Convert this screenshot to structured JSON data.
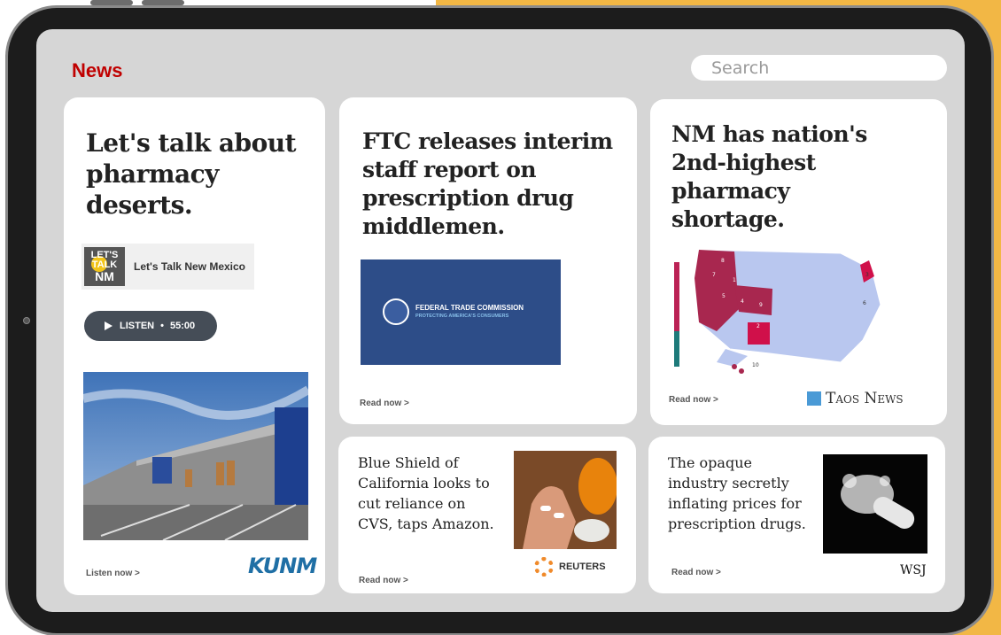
{
  "app": {
    "section_title": "News",
    "search": {
      "placeholder": "Search"
    }
  },
  "cards": [
    {
      "headline": "Let's talk about pharmacy deserts.",
      "podcast_logo_text": [
        "LET'S",
        "TALK",
        "NM"
      ],
      "podcast_name": "Let's Talk New Mexico",
      "listen_label": "LISTEN",
      "listen_separator": "•",
      "duration": "55:00",
      "link": "Listen now >",
      "source": "KUNM"
    },
    {
      "headline": "FTC releases interim staff report on prescription drug middlemen.",
      "image_title": "FEDERAL TRADE COMMISSION",
      "image_subtitle": "PROTECTING AMERICA'S CONSUMERS",
      "link": "Read now >"
    },
    {
      "headline": "NM has nation's 2nd-highest pharmacy shortage.",
      "map_labels": [
        "8",
        "7",
        "1",
        "5",
        "4",
        "9",
        "2",
        "3",
        "6",
        "10"
      ],
      "link": "Read now >",
      "source": "Taos News"
    },
    {
      "headline": "Blue Shield of California looks to cut reliance on CVS, taps Amazon.",
      "link": "Read now >",
      "source": "REUTERS"
    },
    {
      "headline": "The opaque industry secretly inflating prices for prescription drugs.",
      "link": "Read now >",
      "source": "WSJ"
    }
  ],
  "colors": {
    "accent": "#c00000",
    "background_accent": "#f2b745",
    "button": "#454d57"
  }
}
